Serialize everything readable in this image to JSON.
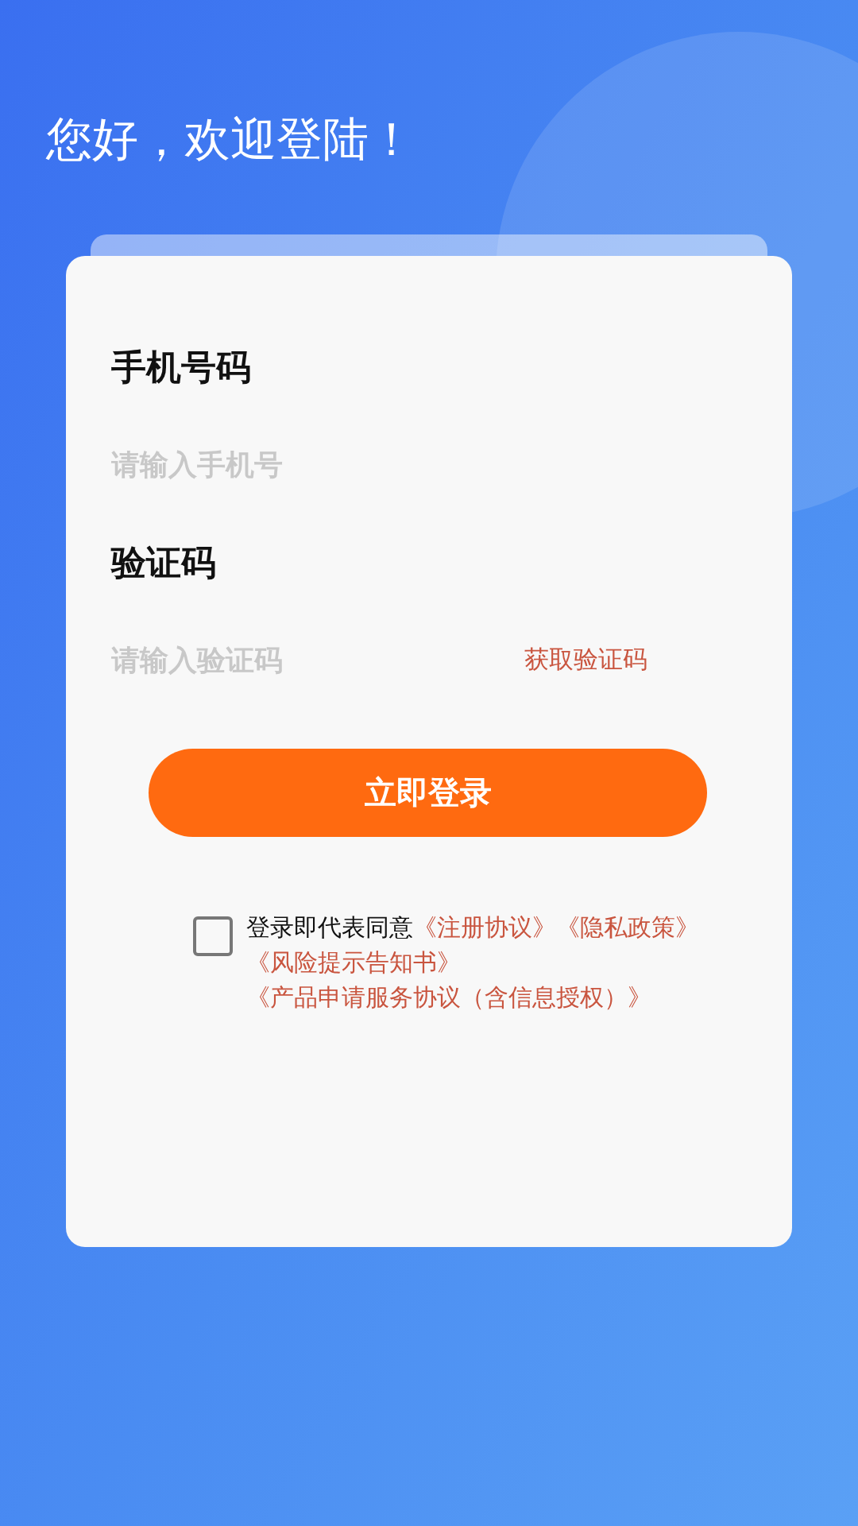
{
  "greeting": "您好，欢迎登陆！",
  "fields": [
    {
      "label": "手机号码",
      "placeholder": "请输入手机号"
    },
    {
      "label": "验证码",
      "placeholder": "请输入验证码",
      "action": "获取验证码"
    }
  ],
  "login_button": "立即登录",
  "agreement": {
    "checked": false,
    "intro": "登录即代表同意",
    "links": [
      "《注册协议》",
      "《隐私政策》",
      "《风险提示告知书》",
      "《产品申请服务协议（含信息授权）》"
    ]
  }
}
